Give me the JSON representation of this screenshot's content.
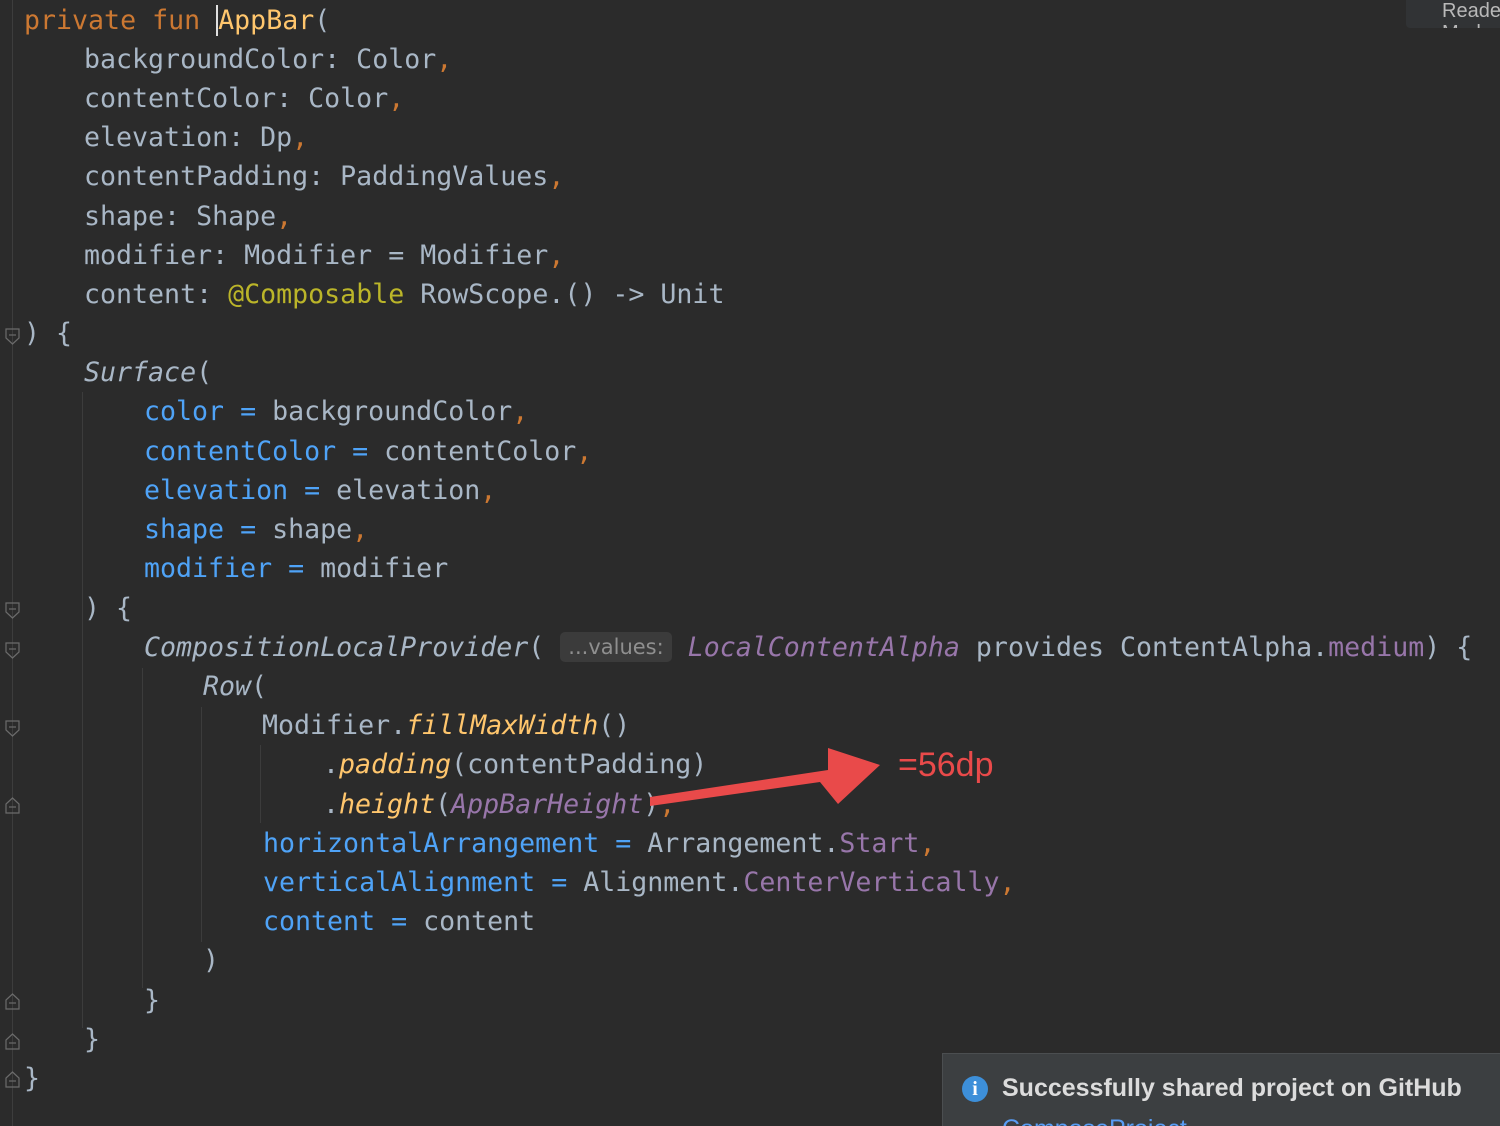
{
  "editor": {
    "reader_mode_label": "Reader Mode",
    "lines": {
      "l1": {
        "t1": "private",
        "t2": "fun",
        "t3": "AppBar",
        "t4": "("
      },
      "l2": {
        "t1": "backgroundColor: Color",
        "t2": ","
      },
      "l3": {
        "t1": "contentColor: Color",
        "t2": ","
      },
      "l4": {
        "t1": "elevation: Dp",
        "t2": ","
      },
      "l5": {
        "t1": "contentPadding: PaddingValues",
        "t2": ","
      },
      "l6": {
        "t1": "shape: Shape",
        "t2": ","
      },
      "l7": {
        "t1": "modifier: Modifier = Modifier",
        "t2": ","
      },
      "l8": {
        "t1": "content: ",
        "t2": "@Composable",
        "t3": " RowScope.() -> Unit"
      },
      "l9": {
        "t1": ") {"
      },
      "l10": {
        "t1": "Surface",
        "t2": "("
      },
      "l11": {
        "t1": "color =",
        "t2": " backgroundColor",
        "t3": ","
      },
      "l12": {
        "t1": "contentColor =",
        "t2": " contentColor",
        "t3": ","
      },
      "l13": {
        "t1": "elevation =",
        "t2": " elevation",
        "t3": ","
      },
      "l14": {
        "t1": "shape =",
        "t2": " shape",
        "t3": ","
      },
      "l15": {
        "t1": "modifier =",
        "t2": " modifier"
      },
      "l16": {
        "t1": ") {"
      },
      "l17": {
        "t1": "CompositionLocalProvider",
        "t2": "(",
        "hint": "...values:",
        "t3": "LocalContentAlpha",
        "t4": " provides ContentAlpha.",
        "t5": "medium",
        "t6": ") {"
      },
      "l18": {
        "t1": "Row",
        "t2": "("
      },
      "l19": {
        "t1": "Modifier.",
        "t2": "fillMaxWidth",
        "t3": "()"
      },
      "l20": {
        "t1": ".",
        "t2": "padding",
        "t3": "(contentPadding)"
      },
      "l21": {
        "t1": ".",
        "t2": "height",
        "t3": "(",
        "t4": "AppBarHeight",
        "t5": ")",
        "t6": ","
      },
      "l22": {
        "t1": "horizontalArrangement =",
        "t2": " Arrangement.",
        "t3": "Start",
        "t4": ","
      },
      "l23": {
        "t1": "verticalAlignment =",
        "t2": " Alignment.",
        "t3": "CenterVertically",
        "t4": ","
      },
      "l24": {
        "t1": "content =",
        "t2": " content"
      },
      "l25": {
        "t1": ")"
      },
      "l26": {
        "t1": "}"
      },
      "l27": {
        "t1": "}"
      },
      "l28": {
        "t1": "}"
      }
    }
  },
  "annotation": {
    "label": "=56dp",
    "color": "#e94a4a"
  },
  "notification": {
    "icon": "info-icon",
    "title": "Successfully shared project on GitHub",
    "link": "ComposeProject"
  },
  "colors": {
    "background": "#2b2b2b",
    "keyword": "#cc7832",
    "function": "#ffc66d",
    "named_param": "#4fa3f7",
    "property": "#9876aa",
    "annotation": "#bbb529",
    "text": "#a9b7c6"
  }
}
